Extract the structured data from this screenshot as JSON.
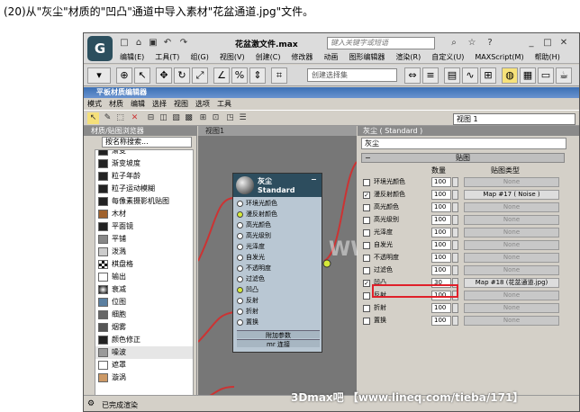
{
  "caption": "(20)从\"灰尘\"材质的\"凹凸\"通道中导入素材\"花盆通道.jpg\"文件。",
  "app": {
    "title": "花盆激文件.max",
    "search_placeholder": "键入关键字或短语",
    "menu": [
      "编辑(E)",
      "工具(T)",
      "组(G)",
      "视图(V)",
      "创建(C)",
      "修改器",
      "动画",
      "图形编辑器",
      "渲染(R)",
      "自定义(U)",
      "MAXScript(M)",
      "帮助(H)"
    ],
    "selection_set": "创建选择集"
  },
  "sme": {
    "title": "平板材质编辑器",
    "menu": [
      "模式",
      "材质",
      "编辑",
      "选择",
      "视图",
      "选项",
      "工具"
    ],
    "view_select": "视图 1"
  },
  "browser": {
    "header": "材质/贴图浏览器",
    "search": "按名称搜索...",
    "items": [
      "渐变",
      "渐变坡度",
      "粒子年龄",
      "粒子运动模糊",
      "每像素摄影机贴图",
      "木材",
      "平面镜",
      "平铺",
      "泼溅",
      "棋盘格",
      "输出",
      "衰减",
      "位图",
      "细胞",
      "烟雾",
      "颜色修正",
      "噪波",
      "遮罩",
      "漩涡"
    ]
  },
  "view": {
    "tab": "视图1"
  },
  "node": {
    "name": "灰尘",
    "type": "Standard",
    "slots": [
      "环境光颜色",
      "漫反射颜色",
      "高光颜色",
      "高光级别",
      "光泽度",
      "自发光",
      "不透明度",
      "过滤色",
      "凹凸",
      "反射",
      "折射",
      "置换"
    ],
    "foot1": "附加参数",
    "foot2": "mr 连接"
  },
  "params": {
    "header": "灰尘 ( Standard )",
    "material_name": "灰尘",
    "rollout": "贴图",
    "col_amount": "数量",
    "col_type": "贴图类型",
    "rows": [
      {
        "label": "环境光颜色",
        "checked": false,
        "amount": "100",
        "map": "None"
      },
      {
        "label": "漫反射颜色",
        "checked": true,
        "amount": "100",
        "map": "Map #17 ( Noise )"
      },
      {
        "label": "高光颜色",
        "checked": false,
        "amount": "100",
        "map": "None"
      },
      {
        "label": "高光级别",
        "checked": false,
        "amount": "100",
        "map": "None"
      },
      {
        "label": "光泽度",
        "checked": false,
        "amount": "100",
        "map": "None"
      },
      {
        "label": "自发光",
        "checked": false,
        "amount": "100",
        "map": "None"
      },
      {
        "label": "不透明度",
        "checked": false,
        "amount": "100",
        "map": "None"
      },
      {
        "label": "过滤色",
        "checked": false,
        "amount": "100",
        "map": "None"
      },
      {
        "label": "凹凸",
        "checked": true,
        "amount": "30",
        "map": "Map #18 (花盆通道.jpg)"
      },
      {
        "label": "反射",
        "checked": false,
        "amount": "100",
        "map": "None"
      },
      {
        "label": "折射",
        "checked": false,
        "amount": "100",
        "map": "None"
      },
      {
        "label": "置换",
        "checked": false,
        "amount": "100",
        "map": "None"
      }
    ]
  },
  "status": "已完成渲染",
  "watermark": "3Dmax吧 【www.lineq.com/tieba/171】",
  "overlay_watermark": "WWW.TLVI.NET"
}
